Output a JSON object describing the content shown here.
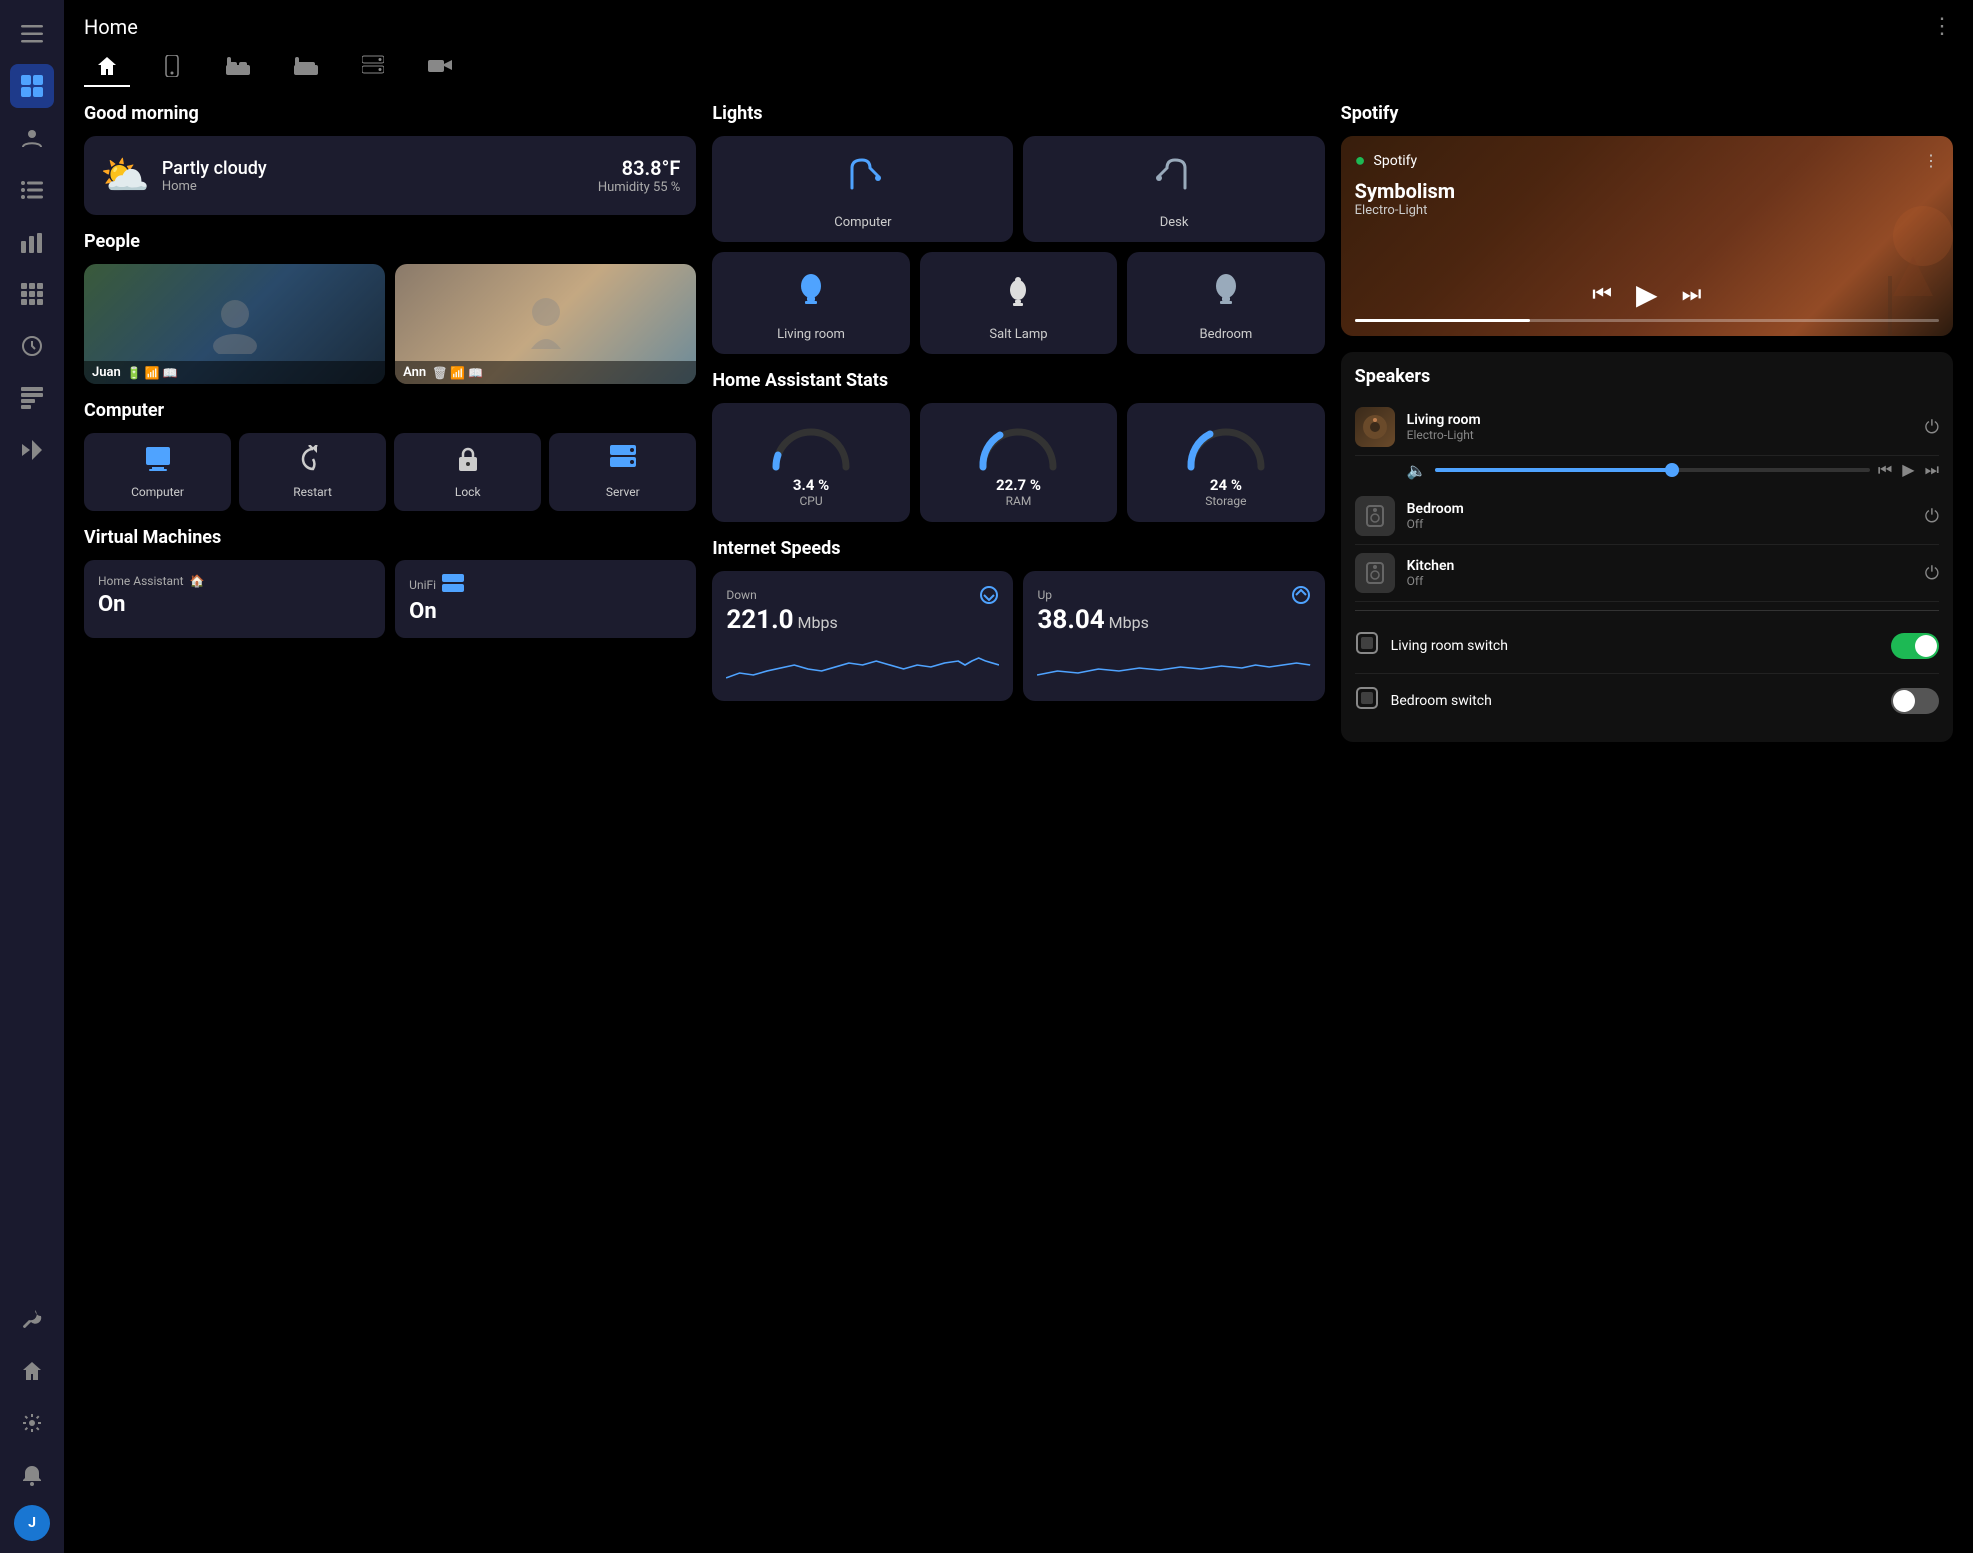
{
  "app": {
    "title": "Home",
    "more_icon": "⋮"
  },
  "sidebar": {
    "menu_icon": "☰",
    "items": [
      {
        "id": "dashboard",
        "icon": "⊞",
        "active": true
      },
      {
        "id": "profile",
        "icon": "👤",
        "active": false
      },
      {
        "id": "list",
        "icon": "☰",
        "active": false
      },
      {
        "id": "chart",
        "icon": "📊",
        "active": false
      },
      {
        "id": "grid",
        "icon": "▦",
        "active": false
      },
      {
        "id": "circle",
        "icon": "◎",
        "active": false
      },
      {
        "id": "hacs",
        "icon": "▤",
        "active": false
      },
      {
        "id": "vscode",
        "icon": "◧",
        "active": false
      }
    ],
    "bottom_items": [
      {
        "id": "wrench",
        "icon": "🔧"
      },
      {
        "id": "home",
        "icon": "🏠"
      },
      {
        "id": "settings",
        "icon": "⚙️"
      }
    ],
    "notification_icon": "🔔",
    "avatar_label": "J"
  },
  "tabs": [
    {
      "id": "home",
      "icon": "🏠",
      "active": true
    },
    {
      "id": "device",
      "icon": "📱",
      "active": false
    },
    {
      "id": "bed1",
      "icon": "🛏",
      "active": false
    },
    {
      "id": "bed2",
      "icon": "🛌",
      "active": false
    },
    {
      "id": "server",
      "icon": "🖥",
      "active": false
    },
    {
      "id": "camera",
      "icon": "📷",
      "active": false
    }
  ],
  "greeting": {
    "title": "Good morning"
  },
  "weather": {
    "condition": "Partly cloudy",
    "location": "Home",
    "temperature": "83.8°F",
    "humidity": "Humidity 55 %",
    "icon": "⛅"
  },
  "people": {
    "title": "People",
    "persons": [
      {
        "name": "Juan",
        "icons": [
          "🔋",
          "📶",
          "📖"
        ],
        "color1": "#3a5a3a",
        "color2": "#2a4a6a"
      },
      {
        "name": "Ann",
        "icons": [
          "🗑",
          "📶",
          "📖"
        ],
        "color1": "#8a7a6a",
        "color2": "#9aaa8a"
      }
    ]
  },
  "computer": {
    "title": "Computer",
    "buttons": [
      {
        "label": "Computer",
        "icon": "💻",
        "blue": true
      },
      {
        "label": "Restart",
        "icon": "↺",
        "blue": false
      },
      {
        "label": "Lock",
        "icon": "🔒",
        "blue": false
      },
      {
        "label": "Server",
        "icon": "🗄",
        "blue": true
      }
    ]
  },
  "virtual_machines": {
    "title": "Virtual Machines",
    "vms": [
      {
        "label": "Home Assistant",
        "icon": "🏠",
        "status": "On"
      },
      {
        "label": "UniFi",
        "icon": "🖥",
        "status": "On"
      }
    ]
  },
  "lights": {
    "title": "Lights",
    "main": [
      {
        "label": "Computer",
        "icon": "💡",
        "color": "blue"
      },
      {
        "label": "Desk",
        "icon": "🔦",
        "color": "dim"
      }
    ],
    "secondary": [
      {
        "label": "Living room",
        "icon": "🪔",
        "color": "blue"
      },
      {
        "label": "Salt Lamp",
        "icon": "🕯",
        "color": "white"
      },
      {
        "label": "Bedroom",
        "icon": "💡",
        "color": "dim"
      }
    ]
  },
  "ha_stats": {
    "title": "Home Assistant Stats",
    "stats": [
      {
        "label": "CPU",
        "value": "3.4 %",
        "percent": 3.4,
        "color": "#4fa3ff"
      },
      {
        "label": "RAM",
        "value": "22.7 %",
        "percent": 22.7,
        "color": "#4fa3ff"
      },
      {
        "label": "Storage",
        "value": "24 %",
        "percent": 24,
        "color": "#4fa3ff"
      }
    ]
  },
  "internet": {
    "title": "Internet Speeds",
    "down": {
      "label": "Down",
      "value": "221.0",
      "unit": "Mbps"
    },
    "up": {
      "label": "Up",
      "value": "38.04",
      "unit": "Mbps"
    }
  },
  "spotify": {
    "title": "Spotify",
    "brand": "Spotify",
    "song": "Symbolism",
    "artist": "Electro-Light",
    "progress": 30,
    "more_icon": "⋮",
    "prev": "⏮",
    "play": "▶",
    "next": "⏭"
  },
  "speakers": {
    "title": "Speakers",
    "items": [
      {
        "name": "Living room",
        "sub": "Electro-Light",
        "has_art": true,
        "volume": 55
      },
      {
        "name": "Bedroom",
        "sub": "Off",
        "has_art": false,
        "volume": 0
      },
      {
        "name": "Kitchen",
        "sub": "Off",
        "has_art": false,
        "volume": 0
      }
    ],
    "transport": {
      "prev": "⏮",
      "play": "▶",
      "next": "⏭"
    }
  },
  "switches": {
    "items": [
      {
        "name": "Living room switch",
        "icon": "🔲",
        "on": true
      },
      {
        "name": "Bedroom switch",
        "icon": "🔲",
        "on": false
      }
    ]
  }
}
